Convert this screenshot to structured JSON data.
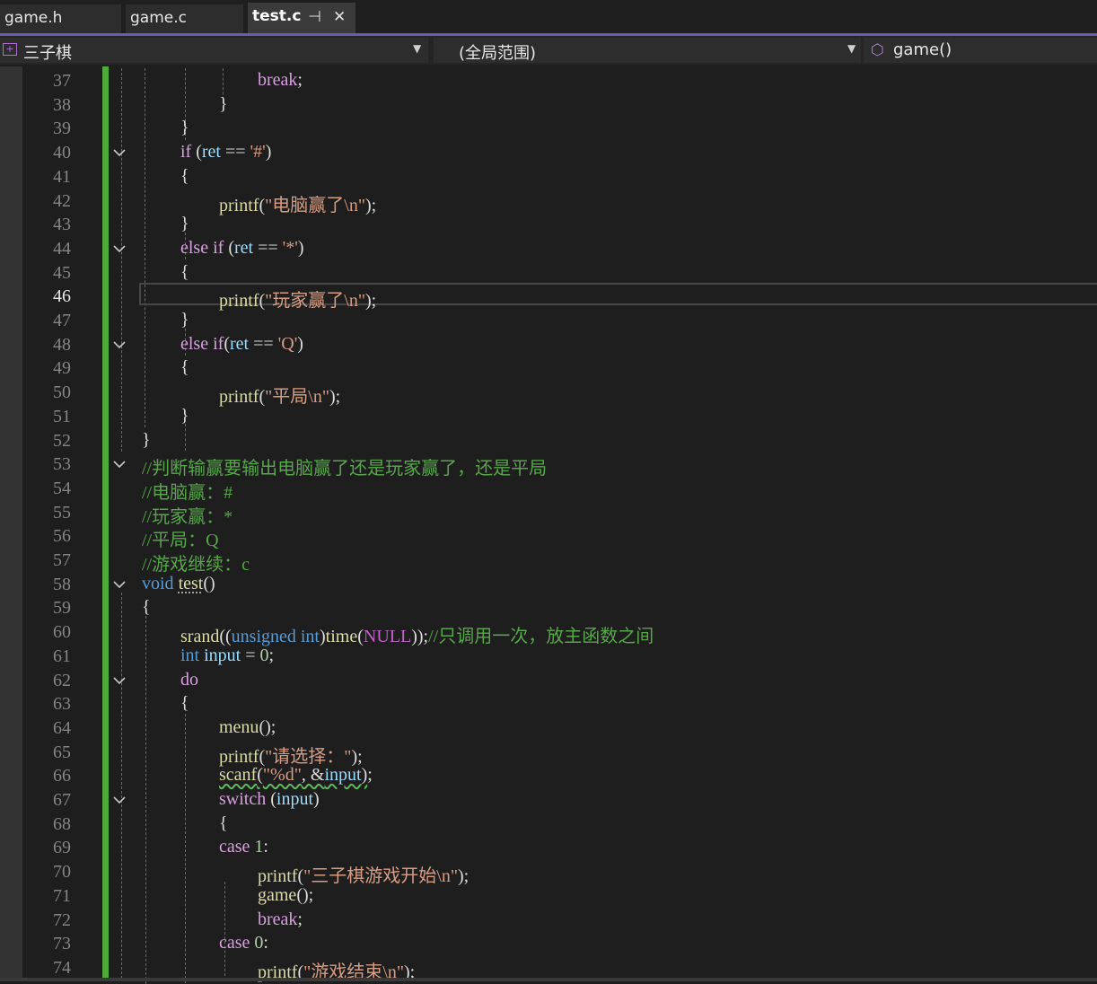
{
  "tabs": [
    {
      "label": "game.h",
      "active": false
    },
    {
      "label": "game.c",
      "active": false
    },
    {
      "label": "test.c",
      "active": true
    }
  ],
  "tab_icons": {
    "pin": "pin-icon",
    "close": "close-icon"
  },
  "navbar": {
    "project": "三子棋",
    "scope": "(全局范围)",
    "member": "game()"
  },
  "colors": {
    "keyword": "#569cd6",
    "control": "#d8a0df",
    "function": "#dcdcaa",
    "string": "#d69d85",
    "comment": "#57a64a",
    "number": "#b5cea8",
    "change_bar": "#4eaa3b",
    "accent": "#6b5bb6"
  },
  "current_line": 46,
  "lines": [
    {
      "n": "37",
      "code": "break;"
    },
    {
      "n": "38",
      "code": "}"
    },
    {
      "n": "39",
      "code": "}"
    },
    {
      "n": "40",
      "code": "if (ret == '#')"
    },
    {
      "n": "41",
      "code": "{"
    },
    {
      "n": "42",
      "code": "printf(\"电脑赢了\\n\");"
    },
    {
      "n": "43",
      "code": "}"
    },
    {
      "n": "44",
      "code": "else if (ret == '*')"
    },
    {
      "n": "45",
      "code": "{"
    },
    {
      "n": "46",
      "code": "printf(\"玩家赢了\\n\");"
    },
    {
      "n": "47",
      "code": "}"
    },
    {
      "n": "48",
      "code": "else if(ret == 'Q')"
    },
    {
      "n": "49",
      "code": "{"
    },
    {
      "n": "50",
      "code": "printf(\"平局\\n\");"
    },
    {
      "n": "51",
      "code": "}"
    },
    {
      "n": "52",
      "code": "}"
    },
    {
      "n": "53",
      "code": "//判断输赢要输出电脑赢了还是玩家赢了，还是平局"
    },
    {
      "n": "54",
      "code": "//电脑赢：#"
    },
    {
      "n": "55",
      "code": "//玩家赢：*"
    },
    {
      "n": "56",
      "code": "//平局：Q"
    },
    {
      "n": "57",
      "code": "//游戏继续：c"
    },
    {
      "n": "58",
      "code": "void test()"
    },
    {
      "n": "59",
      "code": "{"
    },
    {
      "n": "60",
      "code": "srand((unsigned int)time(NULL));//只调用一次，放主函数之间"
    },
    {
      "n": "61",
      "code": "int input = 0;"
    },
    {
      "n": "62",
      "code": "do"
    },
    {
      "n": "63",
      "code": "{"
    },
    {
      "n": "64",
      "code": "menu();"
    },
    {
      "n": "65",
      "code": "printf(\"请选择：\");"
    },
    {
      "n": "66",
      "code": "scanf(\"%d\", &input);"
    },
    {
      "n": "67",
      "code": "switch (input)"
    },
    {
      "n": "68",
      "code": "{"
    },
    {
      "n": "69",
      "code": "case 1:"
    },
    {
      "n": "70",
      "code": "printf(\"三子棋游戏开始\\n\");"
    },
    {
      "n": "71",
      "code": "game();"
    },
    {
      "n": "72",
      "code": "break;"
    },
    {
      "n": "73",
      "code": "case 0:"
    },
    {
      "n": "74",
      "code": "printf(\"游戏结束\\n\");"
    }
  ]
}
